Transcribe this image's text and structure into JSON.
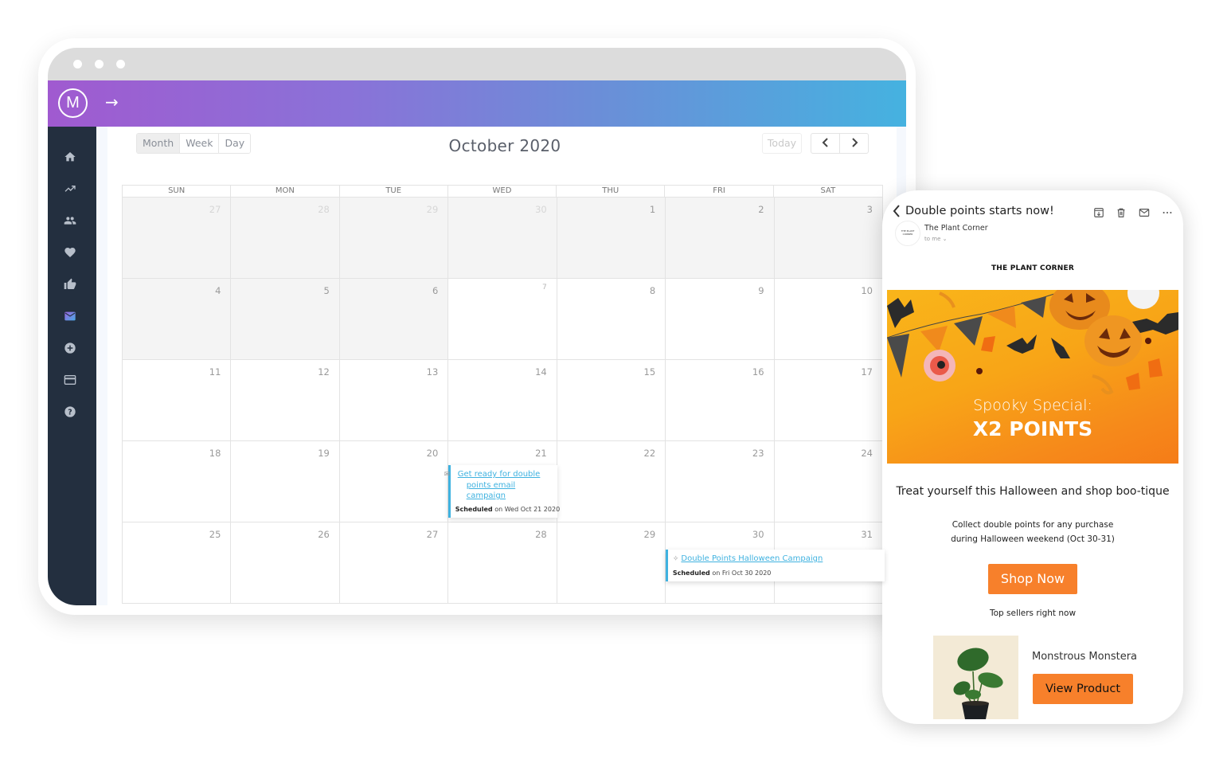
{
  "app": {
    "logo_letter": "M",
    "expand_arrow": "→"
  },
  "sidebar": {
    "items": [
      {
        "icon": "home-icon",
        "label": "Home",
        "active": false
      },
      {
        "icon": "trending-up-icon",
        "label": "Analytics",
        "active": false
      },
      {
        "icon": "people-icon",
        "label": "Customers",
        "active": false
      },
      {
        "icon": "heart-icon",
        "label": "Loyalty",
        "active": false
      },
      {
        "icon": "thumbs-up-icon",
        "label": "Reviews",
        "active": false
      },
      {
        "icon": "mail-icon",
        "label": "Email",
        "active": true
      },
      {
        "icon": "add-circle-icon",
        "label": "Add",
        "active": false
      },
      {
        "icon": "credit-card-icon",
        "label": "Billing",
        "active": false
      },
      {
        "icon": "help-icon",
        "label": "Help",
        "active": false
      }
    ],
    "active_color": "#7b6ee0"
  },
  "calendar": {
    "views": [
      {
        "label": "Month",
        "active": true
      },
      {
        "label": "Week",
        "active": false
      },
      {
        "label": "Day",
        "active": false
      }
    ],
    "title": "October 2020",
    "today_label": "Today",
    "prev_label": "‹",
    "next_label": "›",
    "weekdays": [
      "SUN",
      "MON",
      "TUE",
      "WED",
      "THU",
      "FRI",
      "SAT"
    ],
    "weeks": [
      [
        {
          "n": "27",
          "other": true,
          "past": true
        },
        {
          "n": "28",
          "other": true,
          "past": true
        },
        {
          "n": "29",
          "other": true,
          "past": true
        },
        {
          "n": "30",
          "other": true,
          "past": true
        },
        {
          "n": "1",
          "past": true
        },
        {
          "n": "2",
          "past": true
        },
        {
          "n": "3",
          "past": true
        }
      ],
      [
        {
          "n": "4",
          "past": true
        },
        {
          "n": "5",
          "past": true
        },
        {
          "n": "6",
          "past": true
        },
        {
          "n": "7",
          "today": true
        },
        {
          "n": "8"
        },
        {
          "n": "9"
        },
        {
          "n": "10"
        }
      ],
      [
        {
          "n": "11"
        },
        {
          "n": "12"
        },
        {
          "n": "13"
        },
        {
          "n": "14"
        },
        {
          "n": "15"
        },
        {
          "n": "16"
        },
        {
          "n": "17"
        }
      ],
      [
        {
          "n": "18"
        },
        {
          "n": "19"
        },
        {
          "n": "20"
        },
        {
          "n": "21"
        },
        {
          "n": "22"
        },
        {
          "n": "23"
        },
        {
          "n": "24"
        }
      ],
      [
        {
          "n": "25"
        },
        {
          "n": "26"
        },
        {
          "n": "27"
        },
        {
          "n": "28"
        },
        {
          "n": "29"
        },
        {
          "n": "30"
        },
        {
          "n": "31"
        }
      ]
    ],
    "events": [
      {
        "icon": "envelope-icon",
        "icon_glyph": "✉",
        "title": "Get ready for double points email campaign",
        "status": "Scheduled",
        "date_text": "on Wed Oct 21 2020",
        "week": 3,
        "day": 3
      },
      {
        "icon": "campaign-icon",
        "icon_glyph": "✧",
        "title": "Double Points Halloween Campaign",
        "status": "Scheduled",
        "date_text": "on Fri Oct 30 2020",
        "week": 4,
        "day": 5
      }
    ],
    "event_accent": "#3fb2e0"
  },
  "email": {
    "subject": "Double points starts now!",
    "sender": "The Plant Corner",
    "to": "to me ⌄",
    "avatar_text": "THE PLANT CORNER",
    "actions": [
      "archive-icon",
      "trash-icon",
      "mail-icon",
      "more-icon"
    ],
    "brand": "THE PLANT CORNER",
    "banner": {
      "line1": "Spooky Special:",
      "line2": "X2 POINTS"
    },
    "tagline": "Treat yourself this Halloween and shop boo-tique",
    "body_line1": "Collect double points for any purchase",
    "body_line2": "during Halloween weekend (Oct 30-31)",
    "cta": "Shop Now",
    "top_sellers": "Top sellers right now",
    "product": {
      "name": "Monstrous Monstera",
      "cta": "View Product"
    },
    "accent": "#f7802b"
  }
}
